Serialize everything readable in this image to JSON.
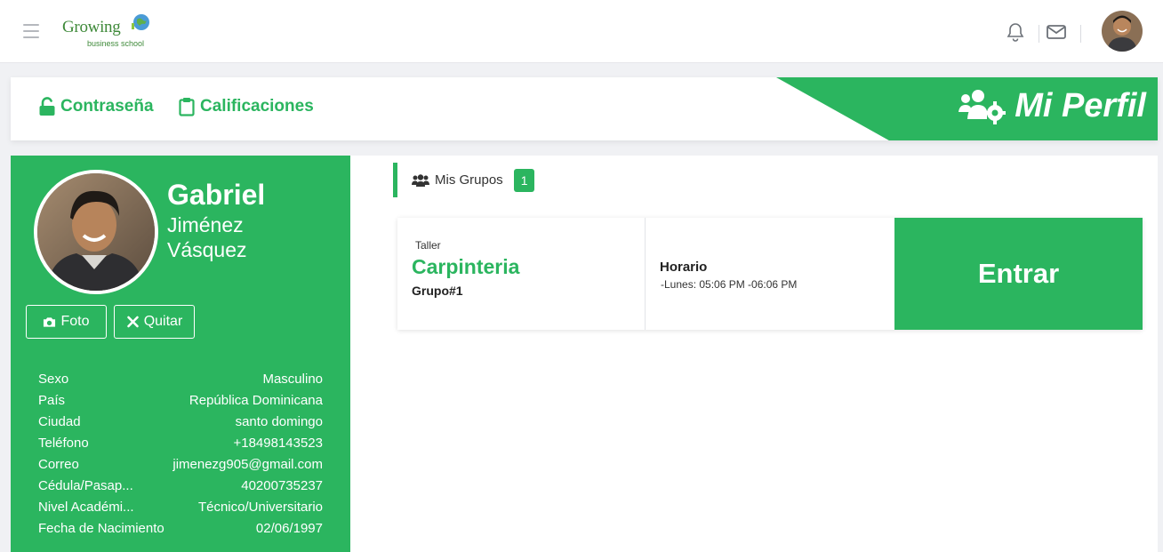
{
  "app": {
    "logo_title": "Growing",
    "logo_subtitle": "business school"
  },
  "header": {
    "links": [
      {
        "label": "Contraseña",
        "icon": "unlock-icon"
      },
      {
        "label": "Calificaciones",
        "icon": "clipboard-icon"
      }
    ],
    "title": "Mi Perfil",
    "title_icon": "users-cog-icon"
  },
  "profile": {
    "first_name": "Gabriel",
    "last_name_1": "Jiménez",
    "last_name_2": "Vásquez",
    "photo_button": "Foto",
    "remove_button": "Quitar",
    "fields": [
      {
        "label": "Sexo",
        "value": "Masculino"
      },
      {
        "label": "País",
        "value": "República Dominicana"
      },
      {
        "label": "Ciudad",
        "value": "santo domingo"
      },
      {
        "label": "Teléfono",
        "value": "+18498143523"
      },
      {
        "label": "Correo",
        "value": "jimenezg905@gmail.com"
      },
      {
        "label": "Cédula/Pasap...",
        "value": "40200735237"
      },
      {
        "label": "Nivel Académi...",
        "value": "Técnico/Universitario"
      },
      {
        "label": "Fecha de Nacimiento",
        "value": "02/06/1997"
      }
    ]
  },
  "groups": {
    "tab_label": "Mis Grupos",
    "count": "1",
    "items": [
      {
        "type": "Taller",
        "name": "Carpinteria",
        "group": "Grupo#1",
        "schedule_label": "Horario",
        "schedule": "-Lunes: 05:06 PM -06:06 PM",
        "action": "Entrar"
      }
    ]
  },
  "colors": {
    "accent": "#2bb55f",
    "background": "#f0f1f4"
  }
}
